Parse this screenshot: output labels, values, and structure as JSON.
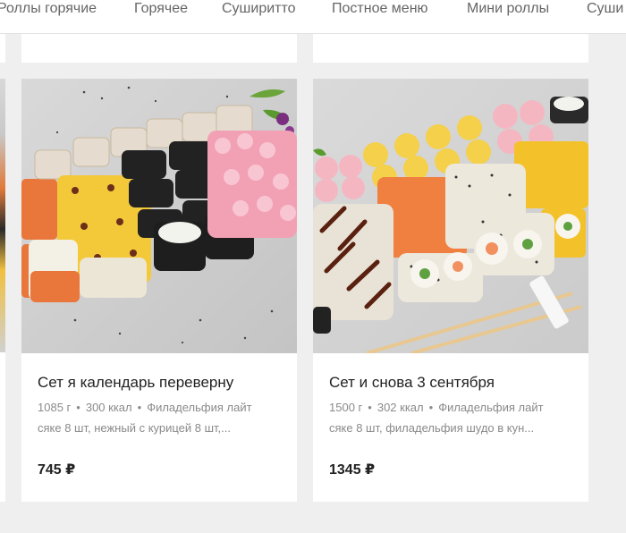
{
  "nav": {
    "items": [
      {
        "label": "Роллы горячие"
      },
      {
        "label": "Горячее"
      },
      {
        "label": "Суширитто"
      },
      {
        "label": "Постное меню"
      },
      {
        "label": "Мини роллы"
      },
      {
        "label": "Суши"
      }
    ]
  },
  "currency": "₽",
  "cards": [
    {
      "title": "Сет я календарь переверну",
      "weight": "1085 г",
      "kcal": "300 ккал",
      "desc_line1": "Филадельфия лайт",
      "desc_line2": "сяке 8 шт, нежный с курицей 8 шт,...",
      "price": "745 ₽"
    },
    {
      "title": "Сет и снова 3 сентября",
      "weight": "1500 г",
      "kcal": "302 ккал",
      "desc_line1": "Филадельфия лайт",
      "desc_line2": "сяке 8 шт, филадельфия шудо в кун...",
      "price": "1345 ₽"
    }
  ],
  "colors": {
    "background": "#efefef",
    "card": "#ffffff",
    "nav_text": "#666666",
    "meta_text": "#8a8a8a"
  }
}
